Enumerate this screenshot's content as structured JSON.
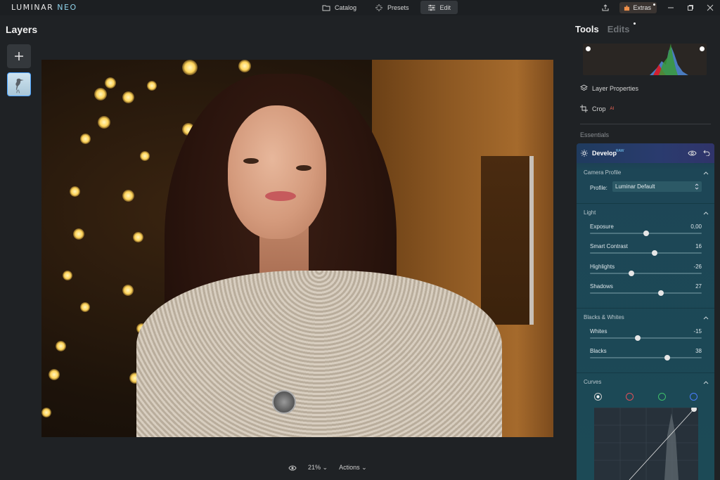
{
  "app": {
    "logo_main": "LUMINAR",
    "logo_suffix": "NEO"
  },
  "nav": {
    "tabs": [
      {
        "label": "Catalog",
        "icon": "folder-icon"
      },
      {
        "label": "Presets",
        "icon": "sparkle-icon"
      },
      {
        "label": "Edit",
        "icon": "sliders-icon",
        "active": true
      }
    ],
    "extras_label": "Extras"
  },
  "layers": {
    "title": "Layers",
    "add_icon": "plus-icon",
    "thumbnail": "heron-thumbnail"
  },
  "bottom": {
    "zoom": "21%",
    "actions_label": "Actions"
  },
  "right": {
    "tabs": [
      "Tools",
      "Edits"
    ],
    "layer_properties_label": "Layer Properties",
    "crop_label": "Crop",
    "crop_badge": "AI",
    "essentials_label": "Essentials",
    "develop": {
      "title": "Develop",
      "badge": "RAW",
      "camera_profile": {
        "heading": "Camera Profile",
        "profile_label": "Profile:",
        "profile_value": "Luminar Default"
      },
      "light": {
        "heading": "Light",
        "sliders": [
          {
            "label": "Exposure",
            "value": "0,00",
            "position": 0.5
          },
          {
            "label": "Smart Contrast",
            "value": "16",
            "position": 0.58
          },
          {
            "label": "Highlights",
            "value": "-26",
            "position": 0.37
          },
          {
            "label": "Shadows",
            "value": "27",
            "position": 0.635
          }
        ]
      },
      "blacks_whites": {
        "heading": "Blacks & Whites",
        "sliders": [
          {
            "label": "Whites",
            "value": "-15",
            "position": 0.425
          },
          {
            "label": "Blacks",
            "value": "38",
            "position": 0.69
          }
        ]
      },
      "curves": {
        "heading": "Curves",
        "channels": [
          "luminance",
          "red",
          "green",
          "blue"
        ]
      }
    }
  },
  "colors": {
    "accent": "#4aa3ff",
    "develop_bg": "#1c4a56",
    "panel_bg": "#1f2225",
    "curve_red": "#e0505a",
    "curve_green": "#3fbf6a",
    "curve_blue": "#4a7cff"
  }
}
